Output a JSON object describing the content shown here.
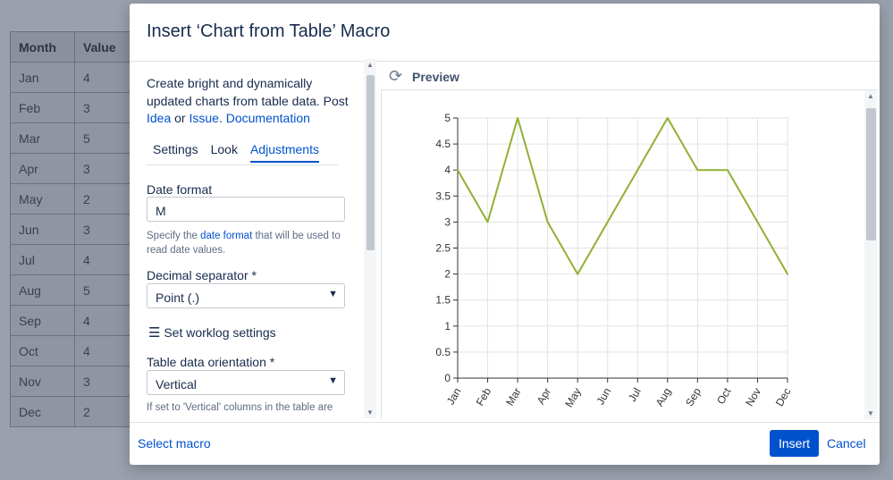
{
  "background_table": {
    "headers": [
      "Month",
      "Value"
    ],
    "rows": [
      [
        "Jan",
        "4"
      ],
      [
        "Feb",
        "3"
      ],
      [
        "Mar",
        "5"
      ],
      [
        "Apr",
        "3"
      ],
      [
        "May",
        "2"
      ],
      [
        "Jun",
        "3"
      ],
      [
        "Jul",
        "4"
      ],
      [
        "Aug",
        "5"
      ],
      [
        "Sep",
        "4"
      ],
      [
        "Oct",
        "4"
      ],
      [
        "Nov",
        "3"
      ],
      [
        "Dec",
        "2"
      ]
    ]
  },
  "dialog": {
    "title": "Insert ‘Chart from Table’ Macro",
    "description": {
      "text": "Create bright and dynamically updated charts from table data. Post",
      "link_idea": "Idea",
      "or": " or ",
      "link_issue": "Issue",
      "dot": ". ",
      "link_docs": "Documentation"
    },
    "tabs": [
      {
        "label": "Settings",
        "active": false
      },
      {
        "label": "Look",
        "active": false
      },
      {
        "label": "Adjustments",
        "active": true
      }
    ],
    "date_format": {
      "label": "Date format",
      "value": "M",
      "help_pre": "Specify the ",
      "help_link": "date format",
      "help_post": " that will be used to read date values."
    },
    "decimal_separator": {
      "label": "Decimal separator *",
      "value": "Point (.)"
    },
    "worklog": {
      "label": "Set worklog settings",
      "icon": "menu-icon"
    },
    "table_orientation": {
      "label": "Table data orientation *",
      "value": "Vertical",
      "help": "If set to 'Vertical' columns in the table are"
    },
    "preview": {
      "title": "Preview",
      "icon": "refresh-icon"
    },
    "footer": {
      "select_macro": "Select macro",
      "insert": "Insert",
      "cancel": "Cancel"
    }
  },
  "chart_data": {
    "type": "line",
    "categories": [
      "Jan",
      "Feb",
      "Mar",
      "Apr",
      "May",
      "Jun",
      "Jul",
      "Aug",
      "Sep",
      "Oct",
      "Nov",
      "Dec"
    ],
    "values": [
      4,
      3,
      5,
      3,
      2,
      3,
      4,
      5,
      4,
      4,
      3,
      2
    ],
    "ylim": [
      0,
      5
    ],
    "yticks": [
      "0",
      "0.5",
      "1",
      "1.5",
      "2",
      "2.5",
      "3",
      "3.5",
      "4",
      "4.5",
      "5"
    ],
    "line_color": "#8fb132",
    "grid": true
  }
}
